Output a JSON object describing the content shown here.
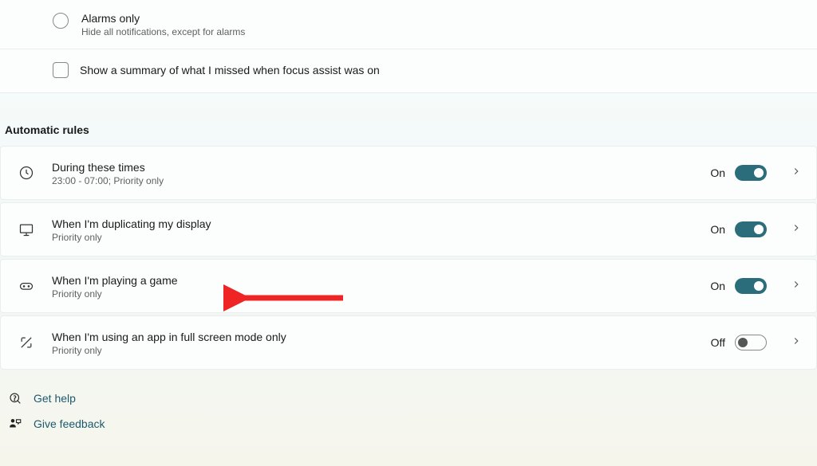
{
  "options": {
    "alarms_only": {
      "title": "Alarms only",
      "sub": "Hide all notifications, except for alarms"
    },
    "summary_checkbox": "Show a summary of what I missed when focus assist was on"
  },
  "section_header": "Automatic rules",
  "rules": [
    {
      "title": "During these times",
      "sub": "23:00 - 07:00; Priority only",
      "state_label": "On",
      "on": true
    },
    {
      "title": "When I'm duplicating my display",
      "sub": "Priority only",
      "state_label": "On",
      "on": true
    },
    {
      "title": "When I'm playing a game",
      "sub": "Priority only",
      "state_label": "On",
      "on": true
    },
    {
      "title": "When I'm using an app in full screen mode only",
      "sub": "Priority only",
      "state_label": "Off",
      "on": false
    }
  ],
  "links": {
    "help": "Get help",
    "feedback": "Give feedback"
  }
}
